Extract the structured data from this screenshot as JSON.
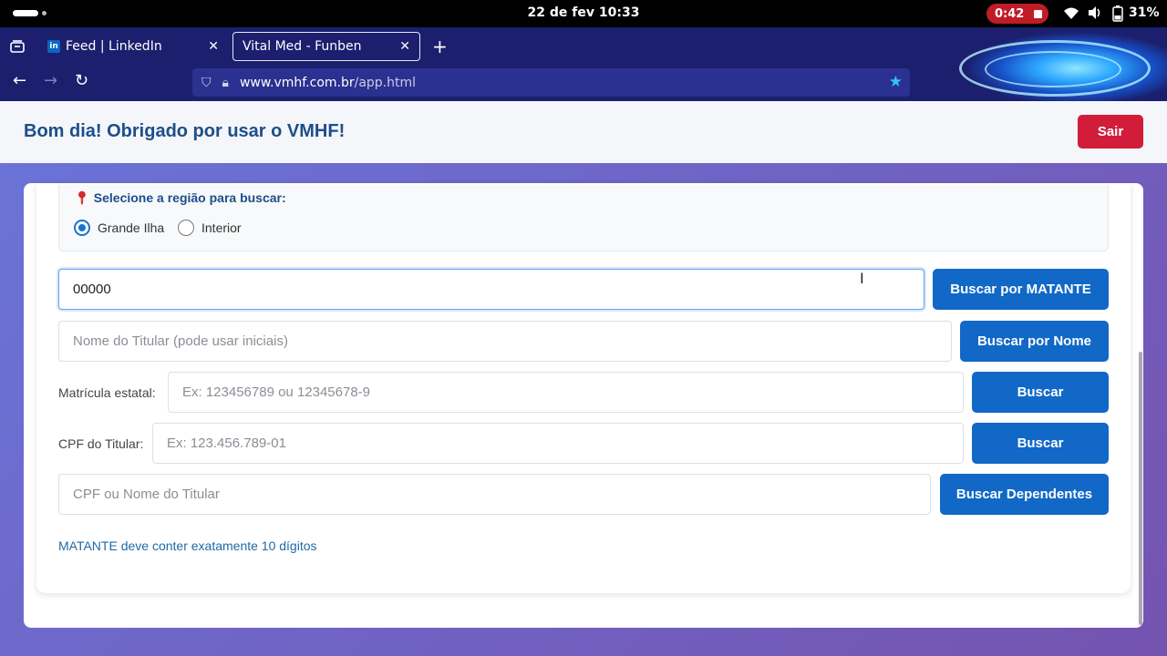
{
  "system": {
    "clock": "22 de fev  10:33",
    "recording": "0:42",
    "battery": "31%"
  },
  "browser": {
    "tabs": [
      {
        "label": "Feed | LinkedIn",
        "favicon": "in"
      },
      {
        "label": "Vital Med - Funben"
      }
    ],
    "url_host": "www.vmhf.com.br",
    "url_path": "/app.html"
  },
  "header": {
    "greeting": "Bom dia! Obrigado por usar o VMHF!",
    "logout_label": "Sair"
  },
  "region": {
    "title": "Selecione a região para buscar:",
    "options": [
      {
        "label": "Grande Ilha",
        "selected": true
      },
      {
        "label": "Interior",
        "selected": false
      }
    ]
  },
  "search": {
    "matante_value": "00000",
    "matante_button": "Buscar por MATANTE",
    "name_placeholder": "Nome do Titular (pode usar iniciais)",
    "name_button": "Buscar por Nome",
    "matricula_label": "Matrícula estatal:",
    "matricula_placeholder": "Ex: 123456789 ou 12345678-9",
    "matricula_button": "Buscar",
    "cpf_label": "CPF do Titular:",
    "cpf_placeholder": "Ex: 123.456.789-01",
    "cpf_button": "Buscar",
    "dependents_placeholder": "CPF ou Nome do Titular",
    "dependents_button": "Buscar Dependentes"
  },
  "message": "MATANTE deve conter exatamente 10 dígitos",
  "colors": {
    "primary": "#1168c7",
    "danger": "#d21d3a",
    "heading": "#1d4e89"
  }
}
